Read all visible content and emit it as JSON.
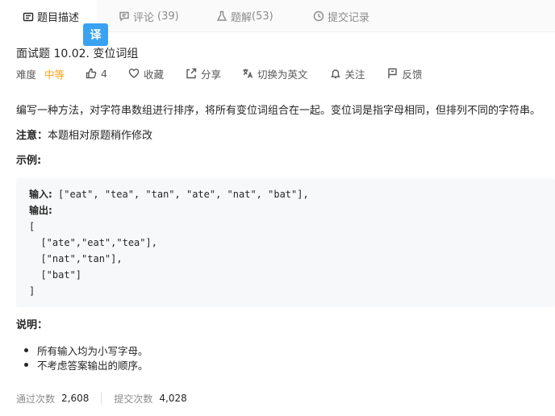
{
  "tabs": [
    {
      "label": "题目描述",
      "count": "",
      "icon": "description-icon",
      "active": true
    },
    {
      "label": "评论",
      "count": "(39)",
      "icon": "comment-icon",
      "active": false
    },
    {
      "label": "题解",
      "count": "(53)",
      "icon": "flask-icon",
      "active": false
    },
    {
      "label": "提交记录",
      "count": "",
      "icon": "history-icon",
      "active": false
    }
  ],
  "translate_badge": "译",
  "problem": {
    "title": "面试题 10.02. 变位词组",
    "difficulty_label": "难度",
    "difficulty": "中等",
    "difficulty_color": "#ffa116",
    "likes": "4",
    "favorite": "收藏",
    "share": "分享",
    "switch_lang": "切换为英文",
    "follow": "关注",
    "feedback": "反馈"
  },
  "content": {
    "description": "编写一种方法，对字符串数组进行排序，将所有变位词组合在一起。变位词是指字母相同，但排列不同的字符串。",
    "note_label": "注意：",
    "note_text": "本题相对原题稍作修改",
    "example_label": "示例:",
    "example": {
      "input_label": "输入:",
      "input_value": " [\"eat\", \"tea\", \"tan\", \"ate\", \"nat\", \"bat\"],",
      "output_label": "输出:",
      "output_lines": [
        "[",
        "  [\"ate\",\"eat\",\"tea\"],",
        "  [\"nat\",\"tan\"],",
        "  [\"bat\"]",
        "]"
      ]
    },
    "explanation_label": "说明：",
    "bullets": [
      "所有输入均为小写字母。",
      "不考虑答案输出的顺序。"
    ]
  },
  "stats": {
    "accepted_label": "通过次数",
    "accepted_value": "2,608",
    "submissions_label": "提交次数",
    "submissions_value": "4,028"
  }
}
